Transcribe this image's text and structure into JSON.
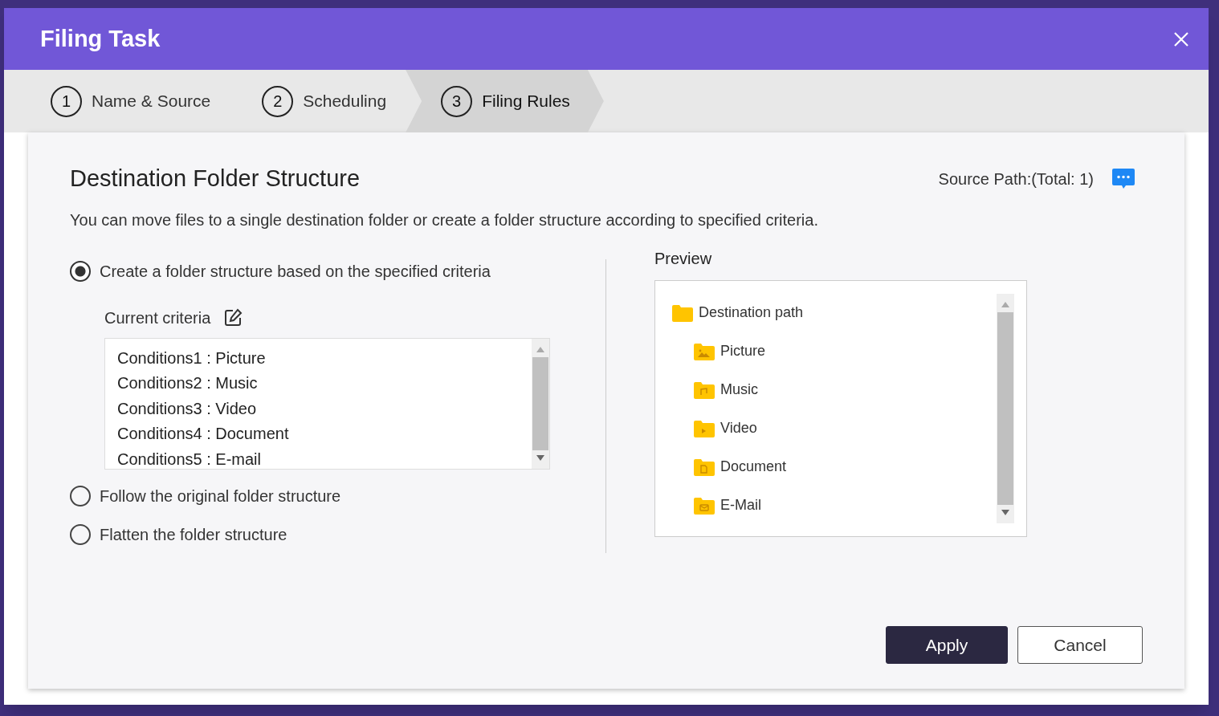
{
  "window": {
    "title": "Filing Task"
  },
  "steps": [
    {
      "number": "1",
      "label": "Name & Source",
      "selected": false
    },
    {
      "number": "2",
      "label": "Scheduling",
      "selected": false
    },
    {
      "number": "3",
      "label": "Filing Rules",
      "selected": true
    }
  ],
  "heading": "Destination Folder Structure",
  "source_path": "Source Path:(Total: 1)",
  "description": "You can move files to a single destination folder or create a folder structure according to specified criteria.",
  "options": [
    {
      "label": "Create a folder structure based on the specified criteria",
      "selected": true,
      "criteria_label": "Current criteria",
      "criteria": [
        "Conditions1 : Picture",
        "Conditions2 : Music",
        "Conditions3 : Video",
        "Conditions4 : Document",
        "Conditions5 : E-mail"
      ]
    },
    {
      "label": "Follow the original folder structure",
      "selected": false
    },
    {
      "label": "Flatten the folder structure",
      "selected": false
    }
  ],
  "preview": {
    "title": "Preview",
    "tree": {
      "label": "Destination path",
      "kind": "folder",
      "children": [
        {
          "label": "Picture",
          "kind": "picture"
        },
        {
          "label": "Music",
          "kind": "music"
        },
        {
          "label": "Video",
          "kind": "video"
        },
        {
          "label": "Document",
          "kind": "document"
        },
        {
          "label": "E-Mail",
          "kind": "email"
        }
      ]
    }
  },
  "buttons": [
    {
      "label": "Apply",
      "kind": "primary"
    },
    {
      "label": "Cancel",
      "kind": "secondary"
    }
  ]
}
